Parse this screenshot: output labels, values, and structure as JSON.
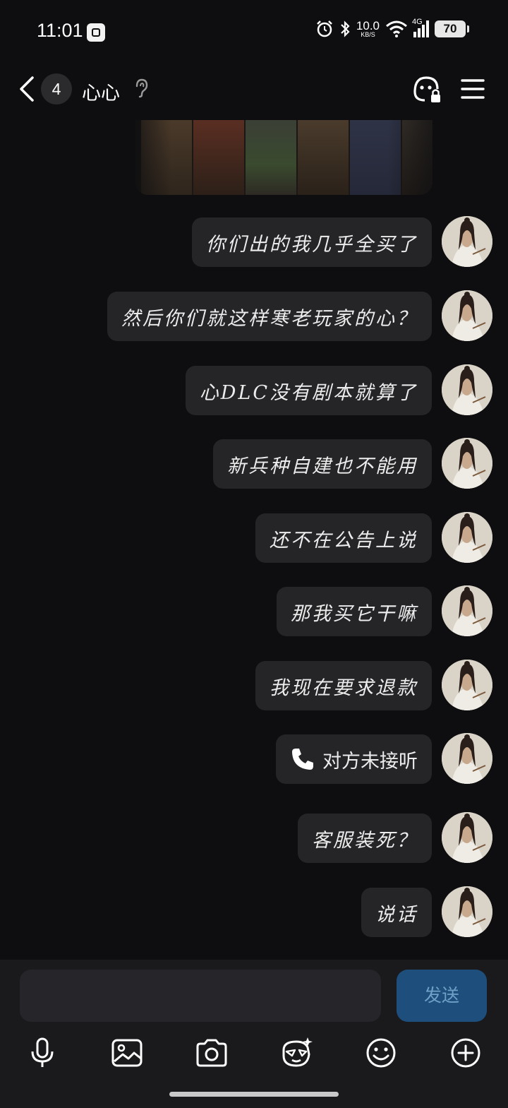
{
  "status_bar": {
    "time": "11:01",
    "network_speed_value": "10.0",
    "network_speed_unit": "KB/S",
    "network_type": "4G",
    "battery": "70"
  },
  "header": {
    "unread_count": "4",
    "contact_name": "心心"
  },
  "messages": [
    {
      "text": "你们出的我几乎全买了"
    },
    {
      "text": "然后你们就这样寒老玩家的心？"
    },
    {
      "text": "心DLC没有剧本就算了"
    },
    {
      "text": "新兵种自建也不能用"
    },
    {
      "text": "还不在公告上说"
    },
    {
      "text": "那我买它干嘛"
    },
    {
      "text": "我现在要求退款"
    },
    {
      "text": "对方未接听",
      "type": "call"
    },
    {
      "text": "客服装死？"
    },
    {
      "text": "说话"
    }
  ],
  "composer": {
    "input_value": "",
    "send_label": "发送"
  },
  "toolbar_icons": [
    "microphone-icon",
    "image-icon",
    "camera-icon",
    "sticker-icon",
    "emoji-icon",
    "plus-icon"
  ],
  "colors": {
    "background": "#0e0e10",
    "bubble": "#252528",
    "send_button": "#1e4f7c",
    "send_text": "#6ea0c8"
  }
}
